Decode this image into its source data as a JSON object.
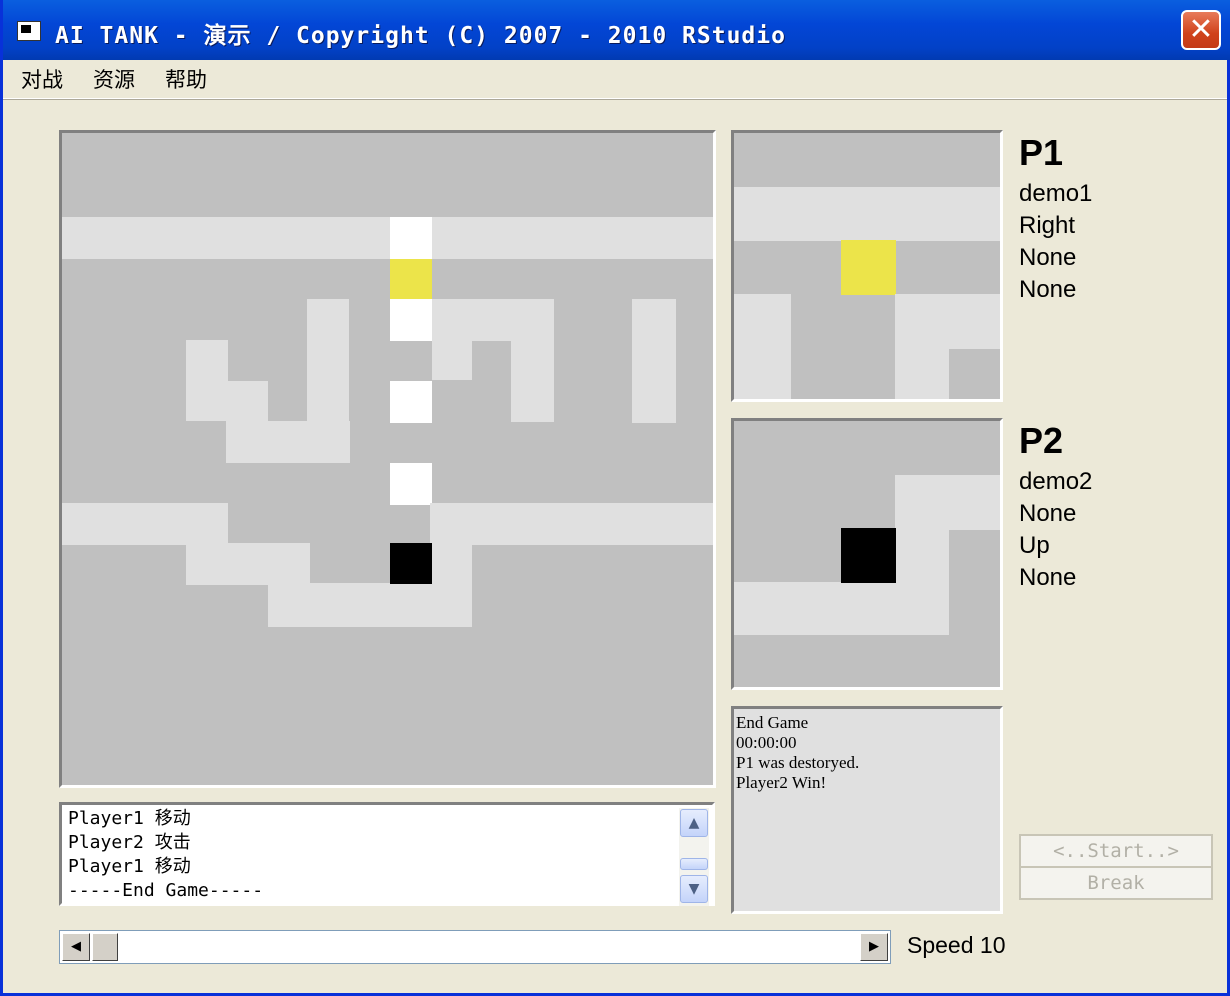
{
  "window": {
    "title": "AI TANK - 演示 / Copyright (C) 2007 - 2010 RStudio",
    "close_glyph": "✕"
  },
  "menu": [
    "对战",
    "资源",
    "帮助"
  ],
  "colors": {
    "floor": "#c0c0c0",
    "road": "#e0e0e0",
    "wall": "#ffffff",
    "p1_tank": "#ece44a",
    "p2_tank": "#000000"
  },
  "players": [
    {
      "title": "P1",
      "name": "demo1",
      "lines": [
        "Right",
        "None",
        "None"
      ]
    },
    {
      "title": "P2",
      "name": "demo2",
      "lines": [
        "None",
        "Up",
        "None"
      ]
    }
  ],
  "log_lines": [
    "Player1 移动",
    "Player2 攻击",
    "Player1 移动",
    "-----End Game-----"
  ],
  "status_lines": [
    "End Game",
    "00:00:00",
    "P1 was destoryed.",
    "Player2 Win!"
  ],
  "buttons": {
    "start": "<..Start..>",
    "break": "Break"
  },
  "speed": {
    "label": "Speed",
    "value": "10"
  },
  "icons": {
    "app": "app-window-icon",
    "close": "close-icon",
    "scroll_up": "up-arrow-icon",
    "scroll_down": "down-arrow-icon",
    "scroll_left": "left-arrow-icon",
    "scroll_right": "right-arrow-icon"
  }
}
